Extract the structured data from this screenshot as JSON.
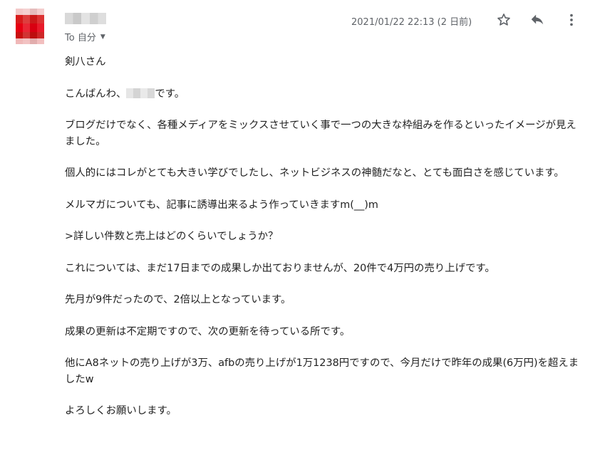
{
  "header": {
    "recipient_label": "To 自分",
    "date": "2021/01/22 22:13 (2 日前)"
  },
  "icons": {
    "star": "star-icon",
    "reply": "reply-icon",
    "more": "more-vert-icon",
    "caret": "caret-down-icon"
  },
  "colors": {
    "text": "#222222",
    "muted": "#5f6368",
    "avatar": "#e60012"
  },
  "message": {
    "greeting": "剣八さん",
    "intro_before": "こんばんわ、",
    "intro_after": "です。",
    "paragraphs": [
      "ブログだけでなく、各種メディアをミックスさせていく事で一つの大きな枠組みを作るといったイメージが見えました。",
      "個人的にはコレがとても大きい学びでしたし、ネットビジネスの神髄だなと、とても面白さを感じています。",
      "メルマガについても、記事に誘導出来るよう作っていきますm(__)m",
      ">詳しい件数と売上はどのくらいでしょうか？",
      "これについては、まだ17日までの成果しか出ておりませんが、20件で4万円の売り上げです。",
      "先月が9件だったので、2倍以上となっています。",
      "成果の更新は不定期ですので、次の更新を待っている所です。",
      "他にA8ネットの売り上げが3万、afbの売り上げが1万1238円ですので、今月だけで昨年の成果(6万円)を超えましたw",
      "よろしくお願いします。"
    ]
  }
}
